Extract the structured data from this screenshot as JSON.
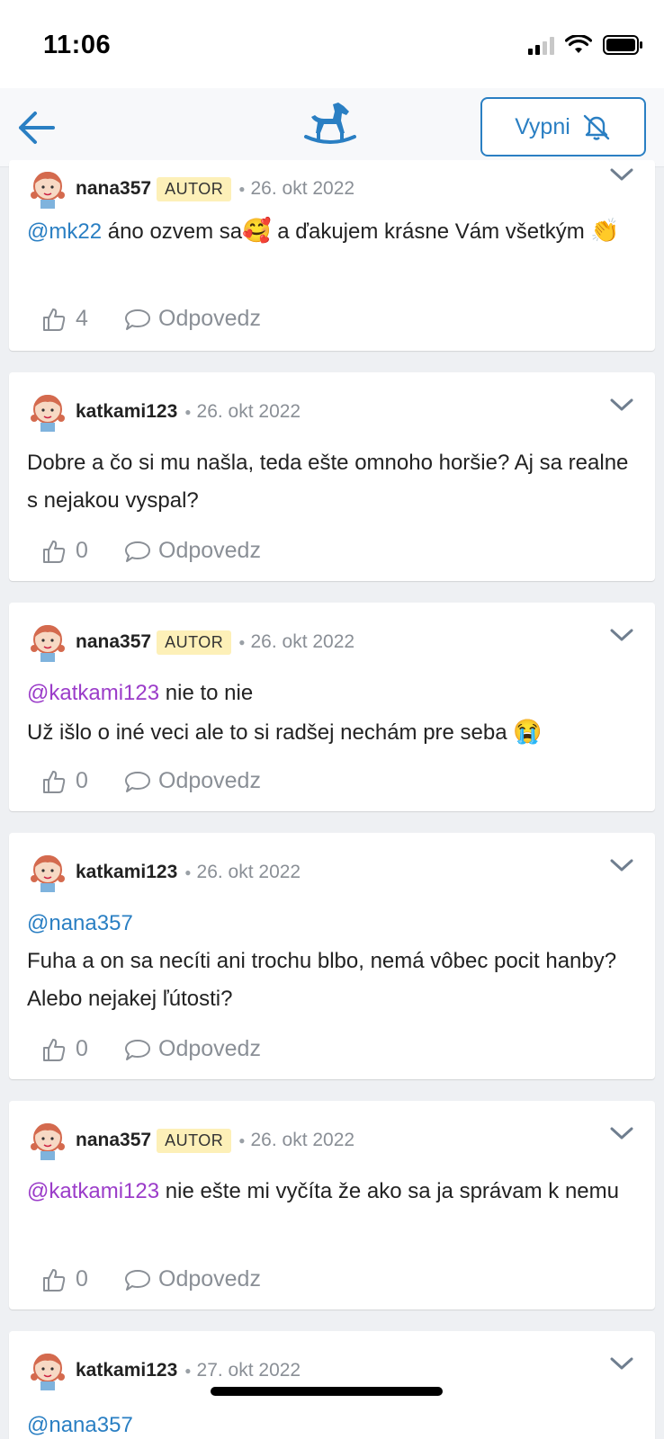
{
  "status_bar": {
    "time": "11:06"
  },
  "nav": {
    "mute_label": "Vypni"
  },
  "actions": {
    "reply_label": "Odpovedz"
  },
  "comments": [
    {
      "username": "nana357",
      "badge": "AUTOR",
      "date": "26. okt 2022",
      "mention": "@mk22",
      "text": " áno ozvem sa",
      "emoji1": "🥰",
      "text2": " a ďakujem krásne Vám všetkým ",
      "emoji2": "👏",
      "likes": "4"
    },
    {
      "username": "katkami123",
      "date": "26. okt 2022",
      "text": "Dobre a čo si mu našla, teda ešte omnoho horšie? Aj sa realne s nejakou vyspal?",
      "likes": "0"
    },
    {
      "username": "nana357",
      "badge": "AUTOR",
      "date": "26. okt 2022",
      "mention": "@katkami123",
      "text": " nie to nie",
      "text2": "Už išlo o iné veci ale to si radšej nechám pre seba ",
      "emoji2": "😭",
      "likes": "0"
    },
    {
      "username": "katkami123",
      "date": "26. okt 2022",
      "mention": "@nana357",
      "text2": "Fuha a on sa necíti ani trochu blbo, nemá vôbec pocit hanby? Alebo nejakej ľútosti?",
      "likes": "0"
    },
    {
      "username": "nana357",
      "badge": "AUTOR",
      "date": "26. okt 2022",
      "mention": "@katkami123",
      "text": " nie ešte mi vyčíta že ako sa ja správam k nemu",
      "likes": "0"
    },
    {
      "username": "katkami123",
      "date": "27. okt 2022",
      "mention": "@nana357"
    }
  ]
}
